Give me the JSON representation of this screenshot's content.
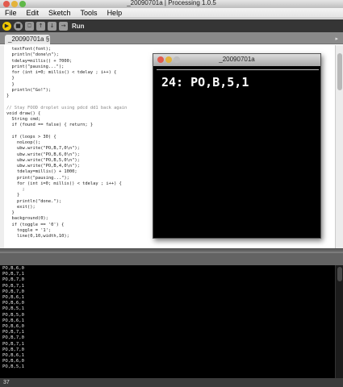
{
  "window": {
    "title": "_20090701a | Processing 1.0.5"
  },
  "menu": {
    "items": [
      "File",
      "Edit",
      "Sketch",
      "Tools",
      "Help"
    ]
  },
  "toolbar": {
    "run_label": "Run",
    "buttons": [
      {
        "name": "run-icon",
        "glyph": "▶"
      },
      {
        "name": "stop-icon",
        "glyph": "■"
      },
      {
        "name": "new-icon",
        "glyph": "⎕"
      },
      {
        "name": "open-icon",
        "glyph": "↑"
      },
      {
        "name": "save-icon",
        "glyph": "↓"
      },
      {
        "name": "export-icon",
        "glyph": "→"
      }
    ]
  },
  "tab": {
    "label": "_20090701a §",
    "menu_glyph": "▸"
  },
  "editor": {
    "lines": [
      "  textFont(font);",
      "  println(\"done\\n\");",
      "  tdelay=millis() + 7000;",
      "  print(\"pausing...\");",
      "  for (int i=0; millis() < tdelay ; i++) {",
      "  }",
      "  }",
      "  println(\"Go!\");",
      "}",
      "",
      "// Stay FOOD droplet using pdcd dd1 back again",
      "void draw() {",
      "  String cmd;",
      "  if (found == false) { return; }",
      "",
      "  if (loops > 30) {",
      "    noLoop();",
      "    ubw.write(\"PO,B,7,0\\n\");",
      "    ubw.write(\"PO,B,6,0\\n\");",
      "    ubw.write(\"PO,B,5,0\\n\");",
      "    ubw.write(\"PO,B,4,0\\n\");",
      "    tdelay=millis() + 1000;",
      "    print(\"pausing...\");",
      "    for (int i=0; millis() < tdelay ; i++) {",
      "      ;",
      "    }",
      "    println(\"done.\");",
      "    exit();",
      "  }",
      "  background(0);",
      "  if (toggle == '0') {",
      "    toggle = '1';",
      "    line(0,10,width,10);"
    ]
  },
  "sketch_window": {
    "title": "_20090701a",
    "output_text": "24: PO,B,5,1"
  },
  "console": {
    "lines": [
      "PO,B,6,0",
      "PO,B,7,1",
      "PO,B,7,0",
      "PO,B,7,1",
      "PO,B,7,0",
      "PO,B,6,1",
      "PO,B,6,0",
      "PO,B,5,1",
      "PO,B,5,0",
      "PO,B,6,1",
      "PO,B,6,0",
      "PO,B,7,1",
      "PO,B,7,0",
      "PO,B,7,1",
      "PO,B,7,0",
      "PO,B,6,1",
      "PO,B,6,0",
      "PO,B,5,1"
    ]
  },
  "status": {
    "line_number": "37"
  },
  "colors": {
    "run_button": "#f0c800",
    "toolbar_bg": "#353535",
    "console_bg": "#000000"
  }
}
